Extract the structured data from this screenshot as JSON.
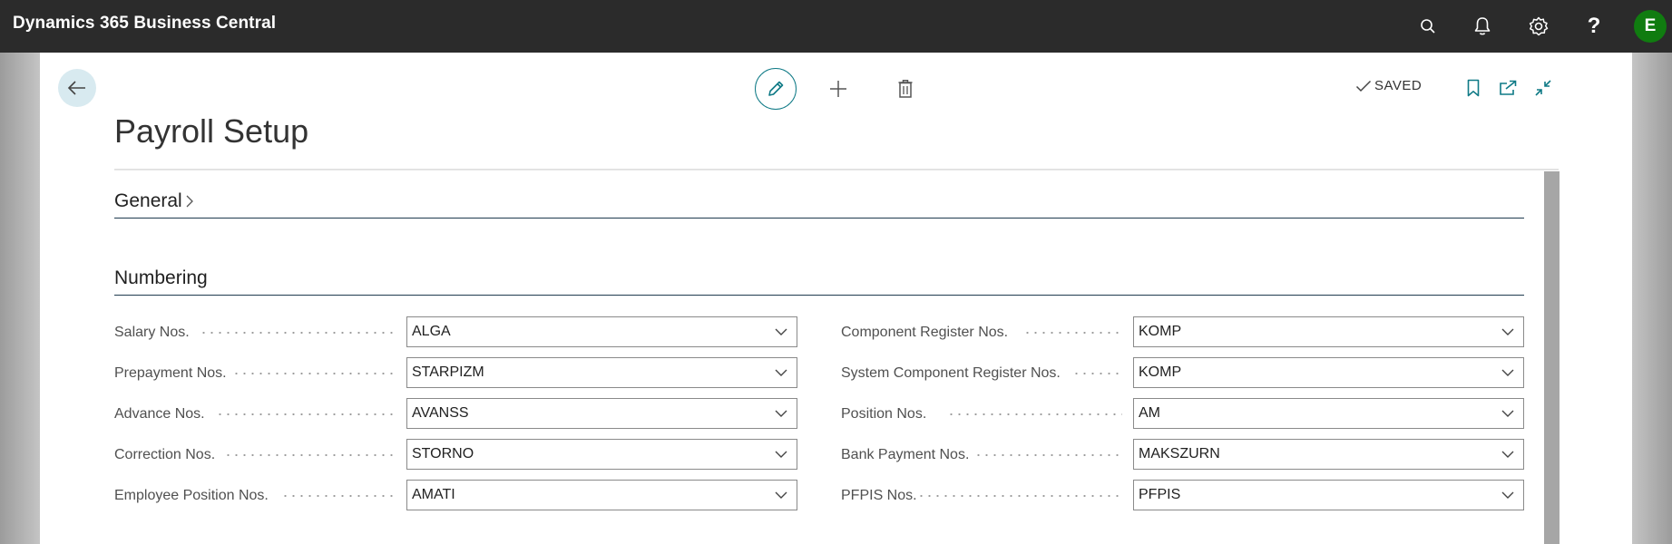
{
  "app": {
    "title": "Dynamics 365 Business Central",
    "user_initial": "E"
  },
  "header": {
    "icons": [
      "search-icon",
      "bell-icon",
      "gear-icon",
      "help-icon"
    ],
    "status": "SAVED"
  },
  "page": {
    "title": "Payroll Setup"
  },
  "sections": {
    "general": {
      "label": "General"
    },
    "numbering": {
      "label": "Numbering",
      "left": [
        {
          "label": "Salary Nos.",
          "value": "ALGA"
        },
        {
          "label": "Prepayment Nos.",
          "value": "STARPIZM"
        },
        {
          "label": "Advance Nos.",
          "value": "AVANSS"
        },
        {
          "label": "Correction Nos.",
          "value": "STORNO"
        },
        {
          "label": "Employee Position Nos.",
          "value": "AMATI"
        }
      ],
      "right": [
        {
          "label": "Component Register Nos.",
          "value": "KOMP"
        },
        {
          "label": "System Component Register Nos.",
          "value": "KOMP"
        },
        {
          "label": "Position Nos.",
          "value": "AM"
        },
        {
          "label": "Bank Payment Nos.",
          "value": "MAKSZURN"
        },
        {
          "label": "PFPIS Nos.",
          "value": "PFPIS"
        }
      ]
    }
  },
  "colors": {
    "accent": "#0f7a86",
    "topbar": "#2b2b2b",
    "avatar": "#107c10"
  }
}
